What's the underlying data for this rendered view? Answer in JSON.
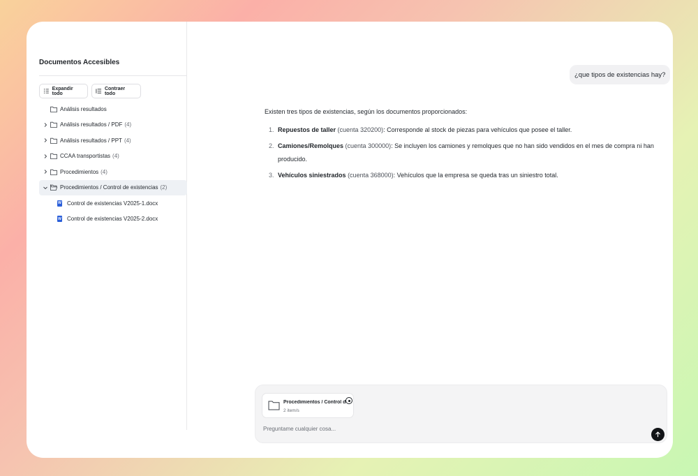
{
  "sidebar": {
    "title": "Documentos Accesibles",
    "expand_label": "Expandir todo",
    "collapse_label": "Contraer todo",
    "tree": [
      {
        "label": "Análisis resultados",
        "count": ""
      },
      {
        "label": "Análisis resultados / PDF",
        "count": "(4)"
      },
      {
        "label": "Análisis resultados / PPT",
        "count": "(4)"
      },
      {
        "label": "CCAA transportistas",
        "count": "(4)"
      },
      {
        "label": "Procedimientos",
        "count": "(4)"
      },
      {
        "label": "Procedimientos / Control de existencias",
        "count": "(2)"
      }
    ],
    "files": [
      {
        "label": "Control de existencias V2025-1.docx",
        "icon": "W"
      },
      {
        "label": "Control de existencias V2025-2.docx",
        "icon": "W"
      }
    ]
  },
  "chat": {
    "user_message": "¿que tipos de existencias hay?",
    "answer_intro": "Existen tres tipos de existencias, según los documentos proporcionados:",
    "items": [
      {
        "num": "1.",
        "title": "Repuestos de taller",
        "account": "(cuenta 320200)",
        "text": ": Corresponde al stock de piezas para vehículos que posee el taller."
      },
      {
        "num": "2.",
        "title": "Camiones/Remolques",
        "account": "(cuenta 300000)",
        "text": ": Se incluyen los camiones y remolques que no han sido vendidos en el mes de compra ni han producido."
      },
      {
        "num": "3.",
        "title": "Vehículos siniestrados",
        "account": "(cuenta 368000)",
        "text": ": Vehículos que la empresa se queda tras un siniestro total."
      }
    ]
  },
  "composer": {
    "attachment_title": "Procedimientos / Control de existencias",
    "attachment_sub": "2 item/s",
    "placeholder": "Preguntame cualquier cosa..."
  }
}
